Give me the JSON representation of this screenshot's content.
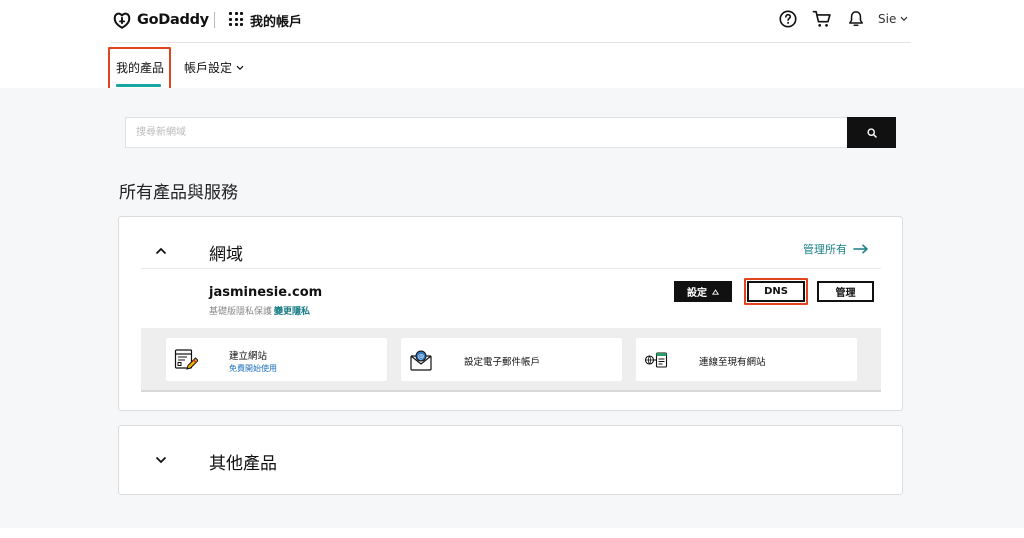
{
  "header": {
    "brand": "GoDaddy",
    "app_title": "我的帳戶",
    "user_name": "Sie",
    "icons": [
      "help-icon",
      "cart-icon",
      "bell-icon",
      "apps-grid-icon"
    ]
  },
  "nav": {
    "tabs": [
      {
        "label": "我的產品",
        "active": true
      },
      {
        "label": "帳戶設定",
        "has_dropdown": true
      }
    ]
  },
  "search": {
    "placeholder": "搜尋新網域",
    "value": ""
  },
  "main": {
    "section_title": "所有產品與服務",
    "domains_card": {
      "title": "網域",
      "manage_all": "管理所有",
      "domain": {
        "name": "jasminesie.com",
        "privacy_text": "基礎版隱私保護",
        "privacy_link": "變更隱私",
        "settings_label": "設定",
        "dns_label": "DNS",
        "manage_label": "管理"
      },
      "tiles": [
        {
          "title": "建立網站",
          "subtitle": "免費開始使用"
        },
        {
          "title": "設定電子郵件帳戶"
        },
        {
          "title": "連線至現有網站"
        }
      ]
    },
    "other_card": {
      "title": "其他產品"
    }
  },
  "colors": {
    "accent_teal": "#1a7f86",
    "tab_underline": "#19a5a1",
    "highlight_red": "#e0451f",
    "link_blue": "#1a6fbf",
    "page_bg": "#f5f7f8"
  }
}
